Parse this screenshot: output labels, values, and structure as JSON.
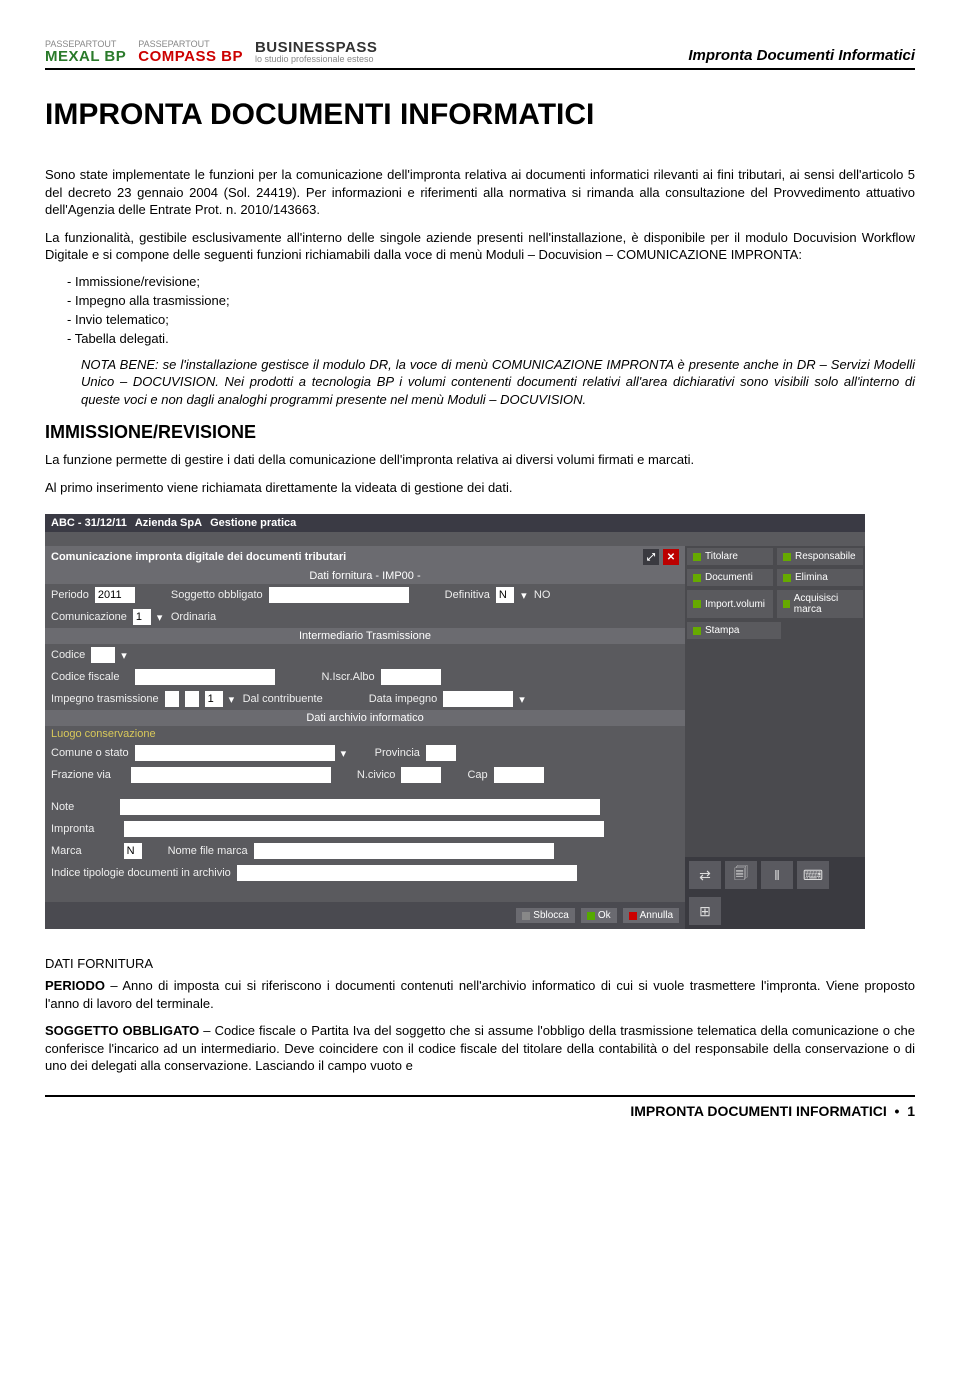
{
  "header": {
    "logos": {
      "mexal": {
        "small": "PASSEPARTOUT",
        "big": "MEXAL BP"
      },
      "compass": {
        "small": "PASSEPARTOUT",
        "big": "COMPASS BP"
      },
      "bpass": {
        "big": "BUSINESSPASS",
        "sub": "lo studio professionale esteso"
      }
    },
    "title": "Impronta Documenti Informatici"
  },
  "title_main": "IMPRONTA DOCUMENTI INFORMATICI",
  "para1": "Sono state implementate le funzioni per la comunicazione dell'impronta relativa ai documenti informatici rilevanti ai fini tributari, ai sensi dell'articolo 5 del decreto 23 gennaio 2004 (Sol. 24419). Per informazioni e riferimenti alla normativa si rimanda alla consultazione del Provvedimento attuativo dell'Agenzia delle Entrate Prot. n. 2010/143663.",
  "para2": "La funzionalità, gestibile esclusivamente all'interno delle singole aziende presenti nell'installazione, è disponibile per il modulo Docuvision Workflow Digitale e si compone delle seguenti funzioni richiamabili dalla voce di menù Moduli – Docuvision – COMUNICAZIONE IMPRONTA:",
  "list": [
    "Immissione/revisione;",
    "Impegno alla trasmissione;",
    "Invio telematico;",
    "Tabella delegati."
  ],
  "note": "NOTA BENE: se l'installazione gestisce il modulo DR, la voce di menù COMUNICAZIONE IMPRONTA è presente anche in DR – Servizi Modelli Unico – DOCUVISION. Nei prodotti a tecnologia BP i volumi contenenti documenti relativi all'area dichiarativi sono visibili solo all'interno di queste voci e non dagli analoghi programmi presente nel menù Moduli – DOCUVISION.",
  "section_heading": "IMMISSIONE/REVISIONE",
  "para3": "La funzione permette di gestire i dati della comunicazione dell'impronta relativa ai diversi volumi firmati e marcati.",
  "para4": "Al primo inserimento viene richiamata direttamente la videata di gestione dei dati.",
  "app": {
    "titlebar": {
      "a": "ABC - 31/12/11",
      "b": "Azienda SpA",
      "c": "Gestione pratica"
    },
    "panel_title": "Comunicazione impronta digitale dei documenti tributari",
    "sec_fornitura": "Dati fornitura  - IMP00 -",
    "lbl_periodo": "Periodo",
    "val_periodo": "2011",
    "lbl_soggetto": "Soggetto obbligato",
    "lbl_definitiva": "Definitiva",
    "val_definitiva_code": "N",
    "val_definitiva": "NO",
    "lbl_comunicazione": "Comunicazione",
    "val_comunicazione_code": "1",
    "val_comunicazione": "Ordinaria",
    "sec_intermediario": "Intermediario Trasmissione",
    "lbl_codice": "Codice",
    "lbl_codfisc": "Codice fiscale",
    "lbl_niscr": "N.Iscr.Albo",
    "lbl_impegno": "Impegno trasmissione",
    "val_impegno_code": "1",
    "val_impegno": "Dal contribuente",
    "lbl_dataimpegno": "Data impegno",
    "sec_archivio": "Dati archivio informatico",
    "lbl_luogo": "Luogo conservazione",
    "lbl_comune": "Comune o stato",
    "lbl_provincia": "Provincia",
    "lbl_frazione": "Frazione via",
    "lbl_ncivico": "N.civico",
    "lbl_cap": "Cap",
    "lbl_note": "Note",
    "lbl_impronta": "Impronta",
    "lbl_marca": "Marca",
    "val_marca": "N",
    "lbl_nomefile": "Nome file marca",
    "lbl_indice": "Indice tipologie documenti in archivio",
    "btn_sblocca": "Sblocca",
    "btn_ok": "Ok",
    "btn_annulla": "Annulla",
    "sidebar": {
      "titolare": "Titolare",
      "responsabile": "Responsabile",
      "documenti": "Documenti",
      "elimina": "Elimina",
      "importvolumi": "Import.volumi",
      "acquisisci": "Acquisisci marca",
      "stampa": "Stampa"
    }
  },
  "dati_fornitura_heading": "DATI FORNITURA",
  "periodo_para": "PERIODO – Anno di imposta cui si riferiscono i documenti contenuti nell'archivio informatico di cui si vuole trasmettere l'impronta. Viene proposto l'anno di lavoro del terminale.",
  "soggetto_para": "SOGGETTO OBBLIGATO – Codice fiscale o Partita Iva del soggetto che si assume l'obbligo della trasmissione telematica della comunicazione o che conferisce l'incarico ad un intermediario. Deve coincidere con il codice fiscale del titolare della contabilità o del responsabile della conservazione o di uno dei delegati alla conservazione. Lasciando il campo vuoto e",
  "footer": {
    "text": "IMPRONTA DOCUMENTI INFORMATICI",
    "page": "1"
  }
}
